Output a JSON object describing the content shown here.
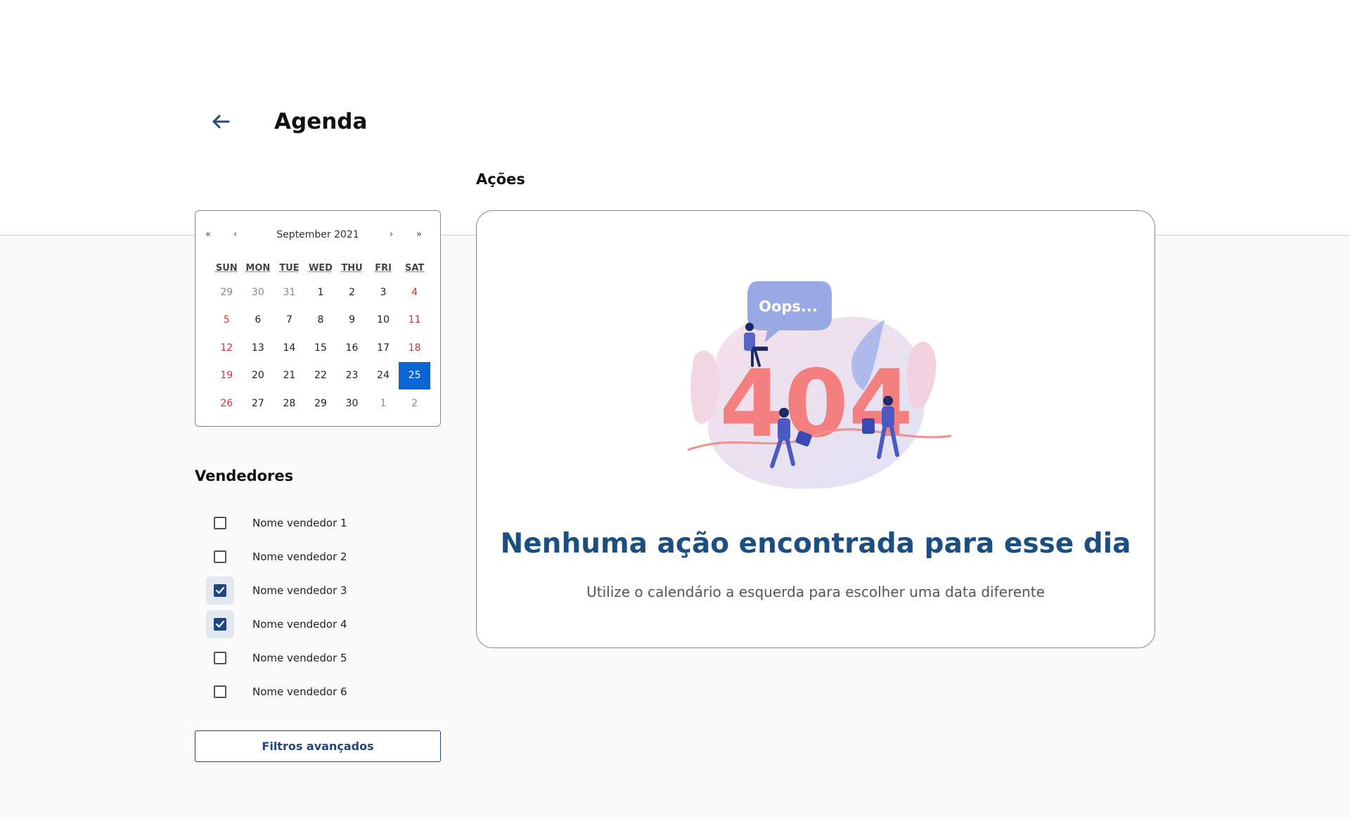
{
  "header": {
    "title": "Agenda",
    "back_icon": "arrow-left-icon"
  },
  "actions": {
    "label": "Ações"
  },
  "calendar": {
    "nav": {
      "prev_year": "«",
      "prev_month": "‹",
      "month_label": "September 2021",
      "next_month": "›",
      "next_year": "»"
    },
    "weekdays": [
      "SUN",
      "MON",
      "TUE",
      "WED",
      "THU",
      "FRI",
      "SAT"
    ],
    "selected_day": "25",
    "weeks": [
      [
        "29",
        "30",
        "31",
        "1",
        "2",
        "3",
        "4"
      ],
      [
        "5",
        "6",
        "7",
        "8",
        "9",
        "10",
        "11"
      ],
      [
        "12",
        "13",
        "14",
        "15",
        "16",
        "17",
        "18"
      ],
      [
        "19",
        "20",
        "21",
        "22",
        "23",
        "24",
        "25"
      ],
      [
        "26",
        "27",
        "28",
        "29",
        "30",
        "1",
        "2"
      ]
    ],
    "colors": {
      "selected": "#0a66d4",
      "weekend": "#d0313b",
      "outside_month": "#8a8a8a"
    }
  },
  "vendors": {
    "label": "Vendedores",
    "items": [
      {
        "name": "Nome vendedor 1",
        "checked": false
      },
      {
        "name": "Nome vendedor 2",
        "checked": false
      },
      {
        "name": "Nome vendedor 3",
        "checked": true
      },
      {
        "name": "Nome vendedor 4",
        "checked": true
      },
      {
        "name": "Nome vendedor 5",
        "checked": false
      },
      {
        "name": "Nome vendedor 6",
        "checked": false
      }
    ]
  },
  "filters": {
    "button_label": "Filtros avançados"
  },
  "empty_state": {
    "illustration_text": "Oops...",
    "illustration_number": "404",
    "title": "Nenhuma ação encontrada para esse dia",
    "subtitle": "Utilize o calendário a esquerda para escolher uma data diferente"
  },
  "colors": {
    "accent": "#1c4e80",
    "primary_button": "#23477d",
    "checkbox_checked": "#1d4687"
  }
}
